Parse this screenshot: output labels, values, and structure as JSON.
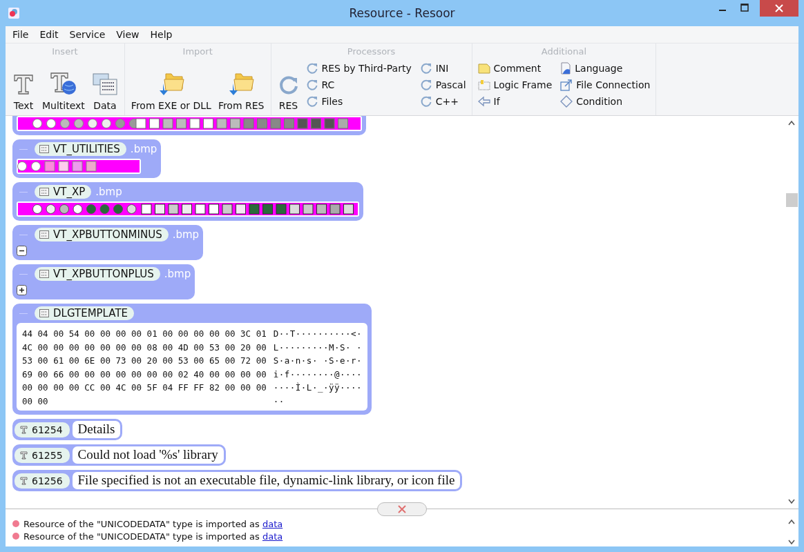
{
  "window": {
    "title": "Resource - Resoor"
  },
  "menu": [
    "File",
    "Edit",
    "Service",
    "View",
    "Help"
  ],
  "ribbon": [
    {
      "title": "Insert",
      "large": [
        {
          "label": "Text",
          "kind": "text"
        },
        {
          "label": "Multitext",
          "kind": "multitext"
        },
        {
          "label": "Data",
          "kind": "data"
        }
      ]
    },
    {
      "title": "Import",
      "large": [
        {
          "label": "From EXE or DLL",
          "kind": "import"
        },
        {
          "label": "From RES",
          "kind": "import"
        }
      ]
    },
    {
      "title": "Processors",
      "large": [
        {
          "label": "RES",
          "kind": "processor"
        }
      ],
      "small": [
        {
          "label": "RES by Third-Party",
          "kind": "processor"
        },
        {
          "label": "RC",
          "kind": "processor"
        },
        {
          "label": "Files",
          "kind": "processor"
        },
        {
          "label": "INI",
          "kind": "processor"
        },
        {
          "label": "Pascal",
          "kind": "processor"
        },
        {
          "label": "C++",
          "kind": "processor"
        }
      ]
    },
    {
      "title": "Additional",
      "small": [
        {
          "label": "Comment",
          "kind": "comment"
        },
        {
          "label": "Logic Frame",
          "kind": "frame"
        },
        {
          "label": "If",
          "kind": "if"
        },
        {
          "label": "Language",
          "kind": "language"
        },
        {
          "label": "File Connection",
          "kind": "connection"
        },
        {
          "label": "Condition",
          "kind": "condition"
        }
      ]
    }
  ],
  "resources": [
    {
      "kind": "checkbox_strip"
    },
    {
      "kind": "arrow_strip",
      "name": "VT_UTILITIES",
      "ext": ".bmp"
    },
    {
      "kind": "xp_strip",
      "name": "VT_XP",
      "ext": ".bmp"
    },
    {
      "kind": "minus_icon",
      "name": "VT_XPBUTTONMINUS",
      "ext": ".bmp"
    },
    {
      "kind": "plus_icon",
      "name": "VT_XPBUTTONPLUS",
      "ext": ".bmp"
    },
    {
      "kind": "data",
      "name": "DLGTEMPLATE",
      "rows": [
        {
          "hex": "44 04 00 54 00 00 00 00 01 00 00 00 00 00 3C 01",
          "ascii": "D··T··········<·"
        },
        {
          "hex": "4C 00 00 00 00 00 00 00 08 00 4D 00 53 00 20 00",
          "ascii": "L·········M·S· ·"
        },
        {
          "hex": "53 00 61 00 6E 00 73 00 20 00 53 00 65 00 72 00",
          "ascii": "S·a·n·s· ·S·e·r·"
        },
        {
          "hex": "69 00 66 00 00 00 00 00 00 00 02 40 00 00 00 00",
          "ascii": "i·f········@····"
        },
        {
          "hex": "00 00 00 00 CC 00 4C 00 5F 04 FF FF 82 00 00 00",
          "ascii": "····Ì·L·_·ÿÿ····"
        },
        {
          "hex": "00 00",
          "ascii": "··"
        }
      ]
    },
    {
      "kind": "string",
      "id": "61254",
      "text": "Details"
    },
    {
      "kind": "string",
      "id": "61255",
      "text": "Could not load '%s' library"
    },
    {
      "kind": "string",
      "id": "61256",
      "text": "File specified is not an executable file, dynamic-link library, or icon file"
    }
  ],
  "log": [
    {
      "message": "Resource of the \"UNICODEDATA\" type is imported as",
      "link": "data"
    },
    {
      "message": "Resource of the \"UNICODEDATA\" type is imported as",
      "link": "data"
    }
  ]
}
